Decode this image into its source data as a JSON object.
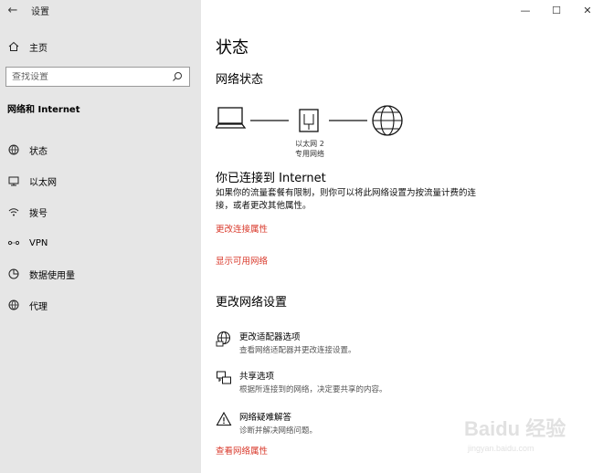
{
  "titlebar": {
    "app_title": "设置"
  },
  "window_controls": {
    "minimize": "—",
    "maximize": "☐",
    "close": "✕"
  },
  "sidebar": {
    "home_label": "主页",
    "search_placeholder": "查找设置",
    "section_title": "网络和 Internet",
    "items": [
      {
        "label": "状态",
        "icon": "status-icon"
      },
      {
        "label": "以太网",
        "icon": "ethernet-icon"
      },
      {
        "label": "拨号",
        "icon": "dialup-icon"
      },
      {
        "label": "VPN",
        "icon": "vpn-icon"
      },
      {
        "label": "数据使用量",
        "icon": "data-usage-icon"
      },
      {
        "label": "代理",
        "icon": "proxy-icon"
      }
    ]
  },
  "main": {
    "page_title": "状态",
    "network_status_title": "网络状态",
    "adapter_name": "以太网 2",
    "adapter_type": "专用网络",
    "connected_title": "你已连接到 Internet",
    "connected_desc": "如果你的流量套餐有限制，则你可以将此网络设置为按流量计费的连接，或者更改其他属性。",
    "link_change_props": "更改连接属性",
    "link_show_available": "显示可用网络",
    "change_settings_title": "更改网络设置",
    "settings": [
      {
        "title": "更改适配器选项",
        "desc": "查看网络适配器并更改连接设置。",
        "icon": "adapter-globe-icon"
      },
      {
        "title": "共享选项",
        "desc": "根据所连接到的网络，决定要共享的内容。",
        "icon": "sharing-icon"
      },
      {
        "title": "网络疑难解答",
        "desc": "诊断并解决网络问题。",
        "icon": "warning-icon"
      }
    ],
    "link_view_props": "查看网络属性"
  },
  "watermark": {
    "main": "Baidu 经验",
    "sub": "jingyan.baidu.com"
  }
}
